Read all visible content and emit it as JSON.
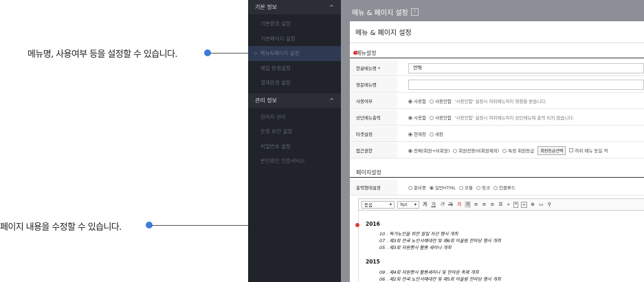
{
  "callouts": {
    "menu": "메뉴명, 사용여부 등을 설정할 수 있습니다.",
    "page": "페이지 내용을 수정할 수 있습니다."
  },
  "sidebar": {
    "groups": [
      {
        "label": "기본 정보",
        "chevron": "^",
        "items": [
          "기본환경 설정",
          "기본페이지 설정",
          "메뉴&페이지 설정",
          "메일 환경설정",
          "결제환경 설정"
        ]
      },
      {
        "label": "관리 정보",
        "chevron": "^",
        "items": [
          "관리자 관리",
          "운영 보안 설정",
          "비밀번호 설정",
          "본인확인 인증서비스"
        ]
      }
    ],
    "active_arrow": ">"
  },
  "header": {
    "title": "메뉴 & 페이지 설정",
    "help": "?"
  },
  "panel": {
    "title": "메뉴 & 페이지 설정",
    "menu_section": "메뉴설정",
    "page_section": "페이지설정",
    "rows": {
      "kor_label": "한글메뉴명 *",
      "kor_value": "연혁",
      "eng_label": "영문메뉴명",
      "eng_value": "",
      "use_label": "사용여부",
      "use_opt1": "사용함",
      "use_opt2": "사용안함",
      "use_hint": "'사용안함' 설정시 하위메뉴까지 영향을 받습니다.",
      "top_label": "상단메뉴출력",
      "top_opt1": "사용함",
      "top_opt2": "사용안함",
      "top_hint": "'사용안함' 설정시 하위메뉴까지 상단메뉴에 출력 되지 않습니다.",
      "target_label": "타겟설정",
      "target_opt1": "현재창",
      "target_opt2": "새창",
      "access_label": "접근권한",
      "access_opt1": "전체(회원+비회원)",
      "access_opt2": "회원전용(비회원제외)",
      "access_opt3": "특정 회원등급",
      "access_btn": "회원등급선택",
      "access_check": "하위 메뉴 동일 적",
      "output_label": "출력형태설정",
      "output_opt1": "준비중",
      "output_opt2": "일반HTML",
      "output_opt3": "모듈",
      "output_opt4": "링크",
      "output_opt5": "인클루드"
    },
    "toolbar": {
      "font": "돋움",
      "size": "9pt",
      "buttons": [
        "가",
        "가",
        "가",
        "가",
        "가",
        "가",
        "가"
      ]
    },
    "history": [
      {
        "year": "2016",
        "events": [
          "10 . 독거노인을 위한 알일 자선 행사 개최",
          "07 . 제3회 전국 노인서예대전 및 제6회 어울림 한마당 행사 개최",
          "05 . 제3회 자원봉사 활동 세미나 개최"
        ]
      },
      {
        "year": "2015",
        "events": [
          "09 . 제4회 자원봉사 활동세미나 및 한마음 축제 개최",
          "06 . 제2회 전국 노인서예대전 및 제5회 어울림 한마당 행사 개최"
        ]
      }
    ]
  }
}
